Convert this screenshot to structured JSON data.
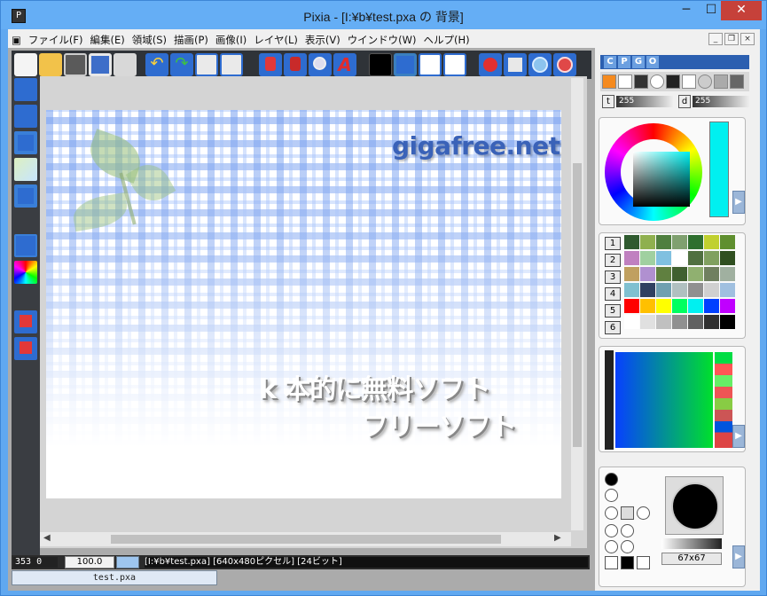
{
  "window": {
    "title": "Pixia - [I:¥b¥test.pxa の 背景]",
    "app_icon": "pixia-icon",
    "controls": {
      "minimize": "─",
      "maximize": "☐",
      "close": "✕"
    }
  },
  "menu": {
    "items": [
      "ファイル(F)",
      "編集(E)",
      "領域(S)",
      "描画(P)",
      "画像(I)",
      "レイヤ(L)",
      "表示(V)",
      "ウインドウ(W)",
      "ヘルプ(H)"
    ],
    "mdi": {
      "minimize": "_",
      "restore": "❐",
      "close": "×"
    }
  },
  "canvas": {
    "brand_text": "gigafree.net",
    "line1": "k 本的に無料ソフト",
    "line2": "フリーソフト"
  },
  "status": {
    "coord": "353 0",
    "zoom": "100.0",
    "info": "[I:¥b¥test.pxa] [640x480ピクセル] [24ビット]",
    "doc_tab": "test.pxa"
  },
  "panel": {
    "tabs": [
      "C",
      "P",
      "G",
      "O"
    ],
    "t_label": "t",
    "t_value": "255",
    "d_label": "d",
    "d_value": "255",
    "palette_rows": [
      "1",
      "2",
      "3",
      "4",
      "5",
      "6"
    ],
    "brush_size": "67x67",
    "expand_arrow": "▶"
  },
  "colors": {
    "current": "#00f0f0",
    "title_bar": "#65aef5",
    "close": "#c6413a"
  }
}
